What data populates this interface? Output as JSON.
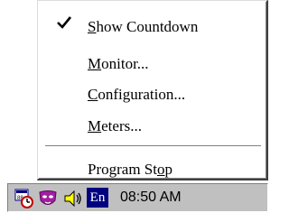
{
  "menu": {
    "items": [
      {
        "pre": "",
        "accel": "S",
        "post": "how Countdown",
        "checked": true
      },
      {
        "pre": "",
        "accel": "M",
        "post": "onitor...",
        "checked": false
      },
      {
        "pre": "",
        "accel": "C",
        "post": "onfiguration...",
        "checked": false
      },
      {
        "pre": "",
        "accel": "M",
        "post": "eters...",
        "checked": false
      },
      {
        "pre": "Program St",
        "accel": "o",
        "post": "p",
        "checked": false
      }
    ],
    "check_icon": "checkmark-icon"
  },
  "taskbar": {
    "icons": [
      "countdown-timer-icon",
      "mask-icon",
      "speaker-icon"
    ],
    "language": "En",
    "clock": "08:50 AM"
  }
}
